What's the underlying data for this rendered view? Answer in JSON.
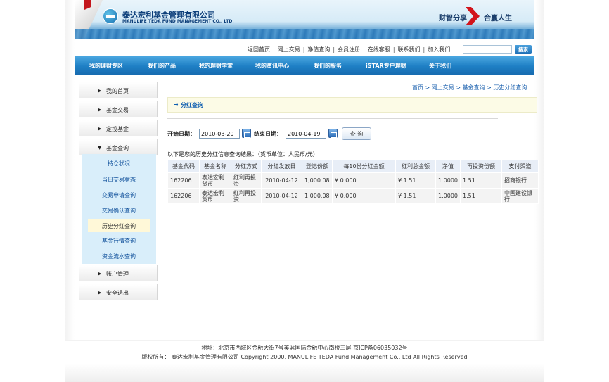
{
  "header": {
    "logo_cn": "泰达宏利基金管理有限公司",
    "logo_en": "MANULIFE TEDA FUND MANAGEMENT CO., LTD.",
    "slogan_left": "财智分享",
    "slogan_right": "合赢人生"
  },
  "toplinks": [
    "返回首页",
    "网上交易",
    "净值查询",
    "会员注册",
    "在线客服",
    "联系我们",
    "加入我们"
  ],
  "search": {
    "placeholder": "",
    "button": "搜索"
  },
  "mainnav": [
    "我的理财专区",
    "我们的产品",
    "我的理财学堂",
    "我的资讯中心",
    "我们的服务",
    "iSTAR专户理财",
    "关于我们"
  ],
  "sidebar": {
    "top_items": [
      "我的首页",
      "基金交易",
      "定投基金",
      "基金查询"
    ],
    "sub_items": [
      "持仓状况",
      "当日交易状态",
      "交易申请查询",
      "交易确认查询",
      "历史分红查询",
      "基金行情查询",
      "资金流水查询"
    ],
    "bottom_items": [
      "账户管理",
      "安全退出"
    ]
  },
  "breadcrumb": [
    "首页",
    "网上交易",
    "基金查询",
    "历史分红查询"
  ],
  "page_title": "分红查询",
  "query": {
    "start_label": "开始日期：",
    "start_value": "2010-03-20",
    "end_label": "结束日期：",
    "end_value": "2010-04-19",
    "button": "查 询"
  },
  "result_caption": "以下是您的历史分红信息查询结果：（货币单位：人民币/元）",
  "table": {
    "columns": [
      "基金代码",
      "基金名称",
      "分红方式",
      "分红发放日",
      "登记份额",
      "每10份分红金额",
      "红利总金额",
      "净值",
      "再投资份额",
      "支付渠道"
    ],
    "rows": [
      [
        "162206",
        "泰达宏利货币",
        "红利再投资",
        "2010-04-12",
        "1,000.08",
        "¥ 0.000",
        "¥ 1.51",
        "1.0000",
        "1.51",
        "招商银行"
      ],
      [
        "162206",
        "泰达宏利货币",
        "红利再投资",
        "2010-04-12",
        "1,000.08",
        "¥ 0.000",
        "¥ 1.51",
        "1.0000",
        "1.51",
        "中国建设银行"
      ]
    ]
  },
  "footer": {
    "address": "地址：北京市西城区金融大街7号英蓝国际金融中心南楼三层  京ICP备06035032号",
    "copyright": "版权所有：  泰达宏利基金管理有限公司  Copyright 2000, MANULIFE TEDA Fund Management Co., Ltd All Rights Reserved"
  }
}
